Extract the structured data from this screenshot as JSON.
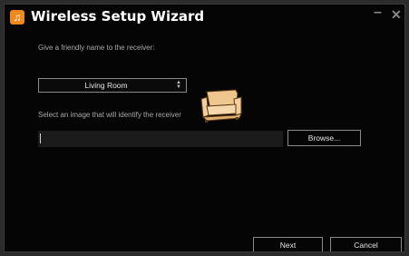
{
  "window": {
    "title": "Wireless Setup Wizard",
    "minimize_glyph": "–",
    "close_glyph": "✕",
    "app_icon_glyph": "♫"
  },
  "form": {
    "name_prompt": "Give a friendly name to the receiver:",
    "receiver_name": "Living Room",
    "image_prompt": "Select an image that will identify the receiver",
    "image_path": ""
  },
  "buttons": {
    "browse": "Browse...",
    "next": "Next",
    "cancel": "Cancel"
  },
  "icons": {
    "app": "music-note-icon",
    "selector": "up-down-arrows-icon",
    "receiver_image": "sofa-icon"
  },
  "colors": {
    "background": "#050505",
    "accent": "#f08a1d",
    "text": "#e6e6e6",
    "muted_text": "#a8a8a8"
  }
}
